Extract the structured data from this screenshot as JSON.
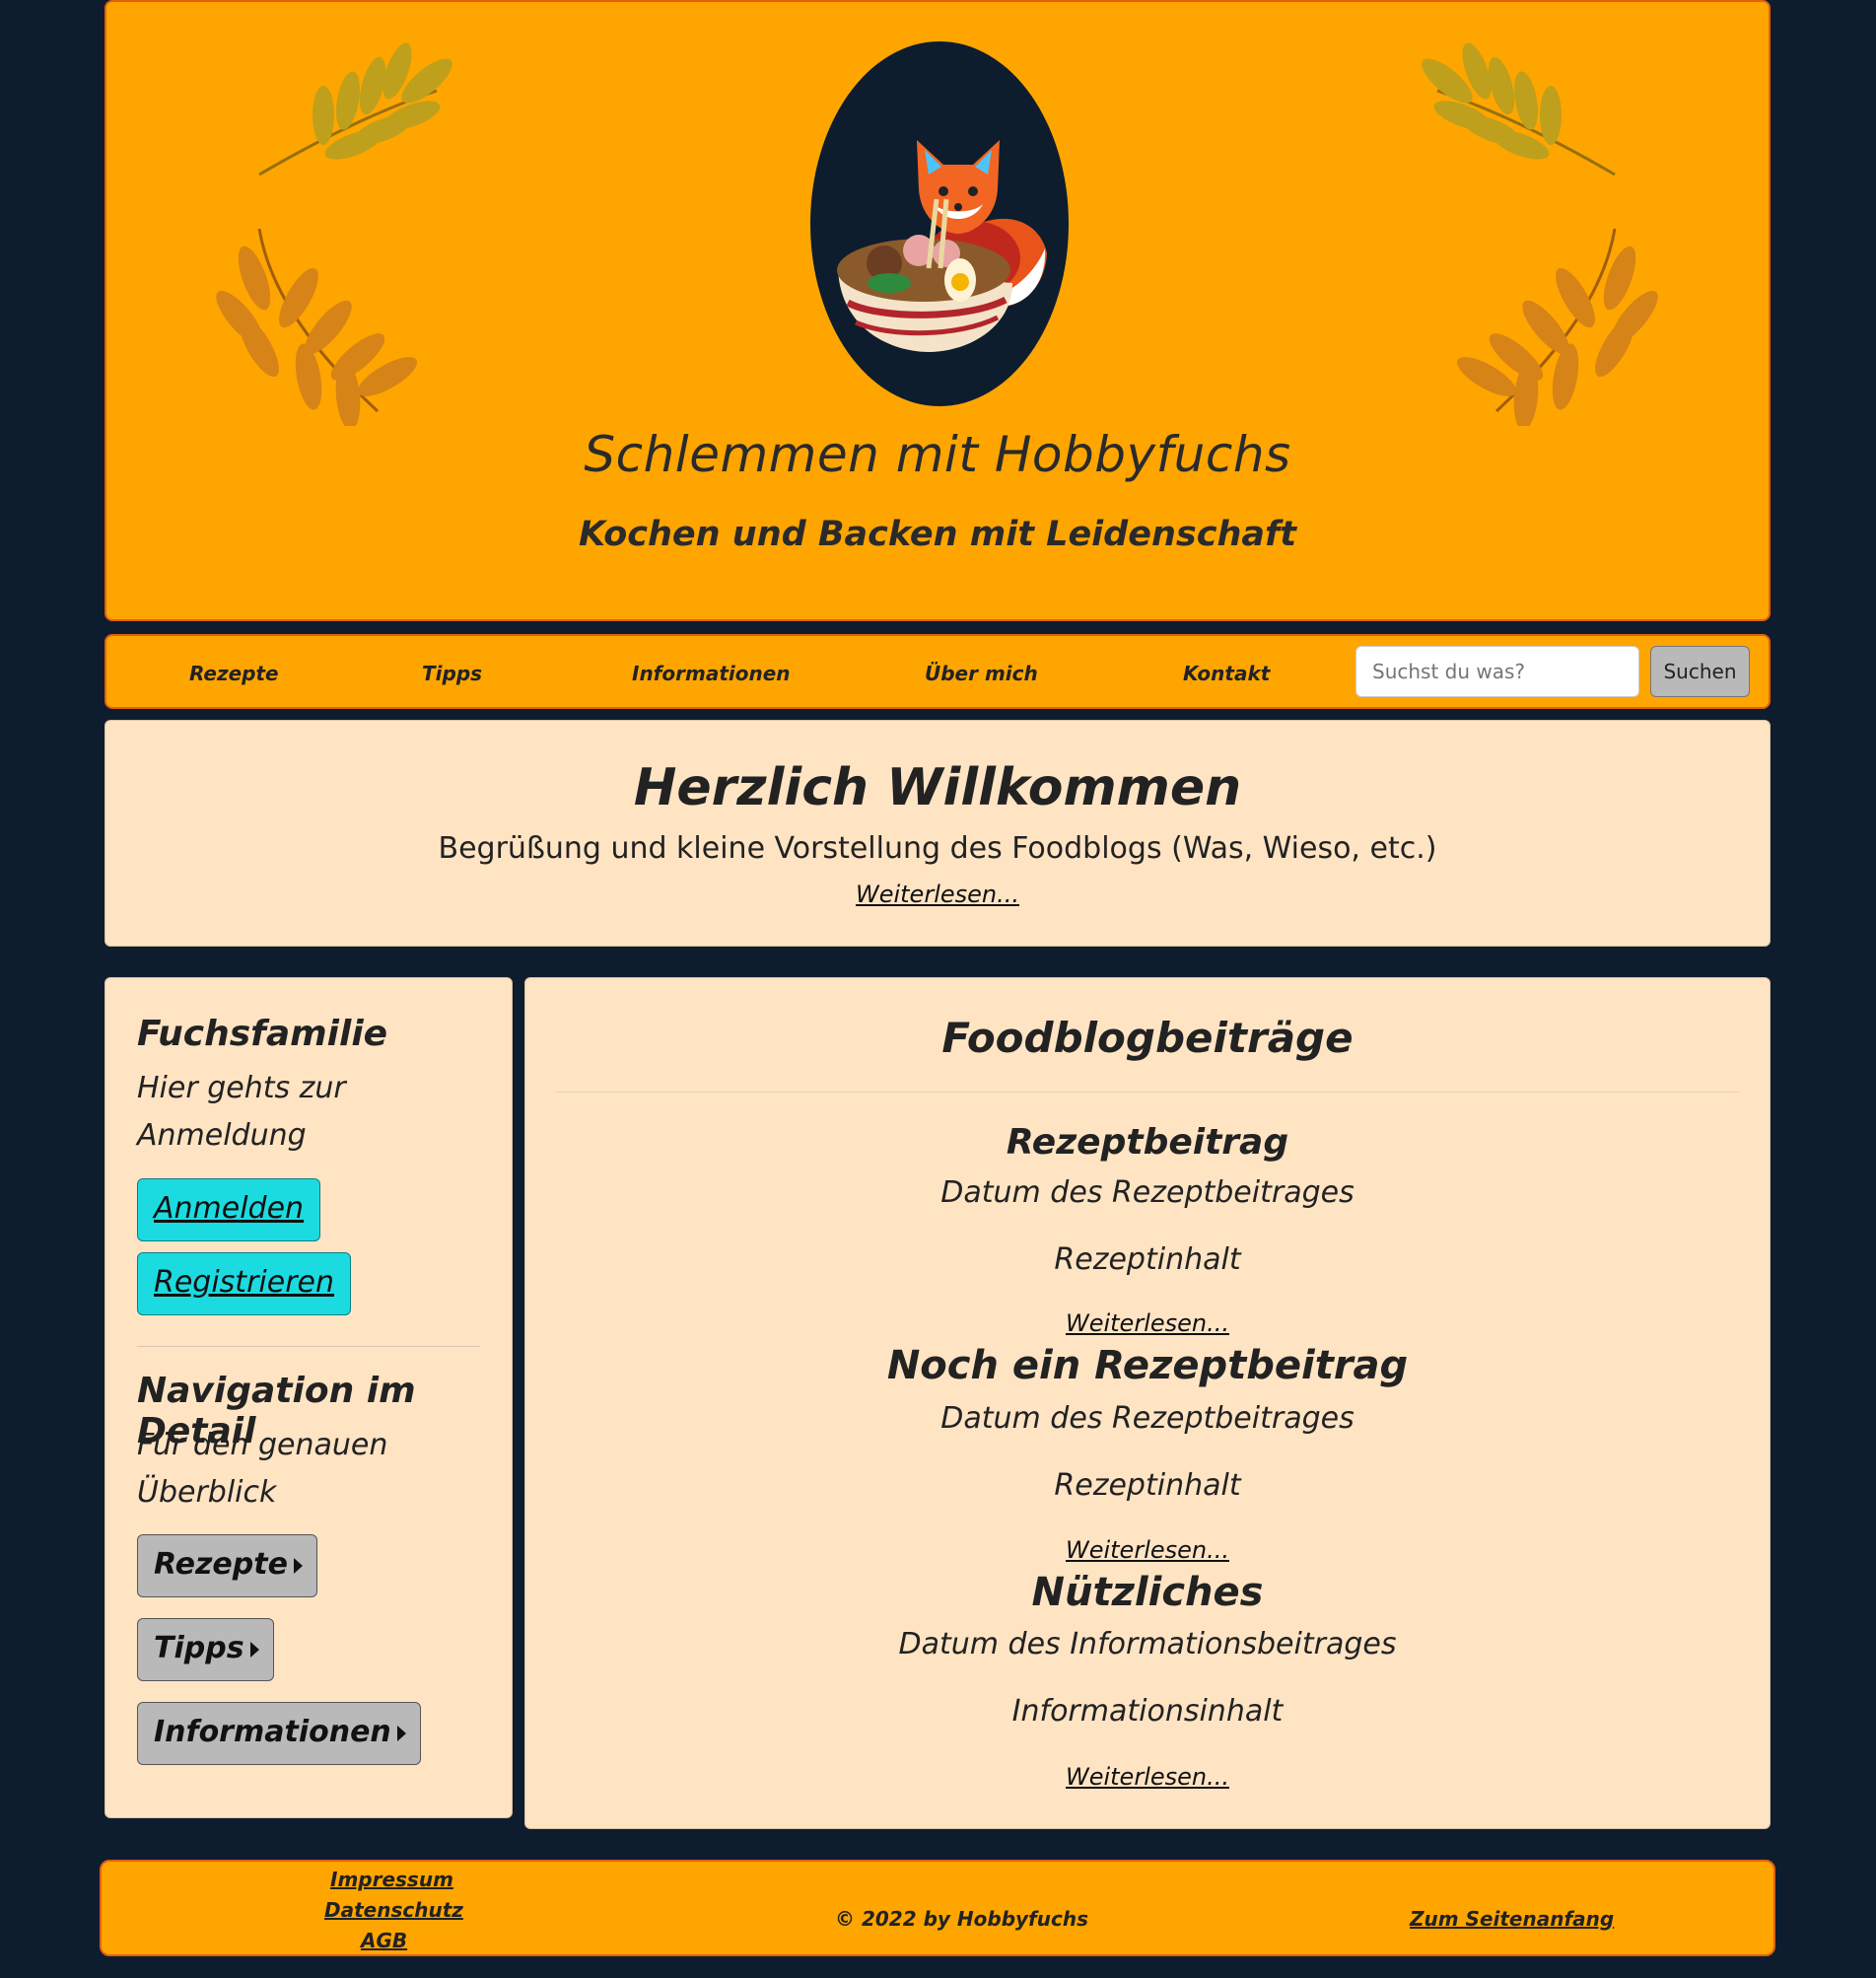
{
  "header": {
    "title": "Schlemmen mit Hobbyfuchs",
    "subtitle": "Kochen und Backen mit Leidenschaft",
    "logo_icon": "fox-ramen-logo",
    "decor_icon": "autumn-leaves-icon"
  },
  "nav": {
    "items": [
      "Rezepte",
      "Tipps",
      "Informationen",
      "Über mich",
      "Kontakt"
    ],
    "search_placeholder": "Suchst du was?",
    "search_button": "Suchen"
  },
  "welcome": {
    "heading": "Herzlich Willkommen",
    "text": "Begrüßung und kleine Vorstellung des Foodblogs (Was, Wieso, etc.)",
    "link": "Weiterlesen..."
  },
  "sidebar": {
    "family_heading": "Fuchsfamilie",
    "family_text": "Hier gehts zur Anmeldung",
    "login_button": "Anmelden",
    "register_button": "Registrieren",
    "nav_heading": "Navigation im Detail",
    "nav_text": "Für den genauen Überblick",
    "nav_buttons": [
      "Rezepte",
      "Tipps",
      "Informationen"
    ]
  },
  "main": {
    "heading": "Foodblogbeiträge",
    "posts": [
      {
        "title": "Rezeptbeitrag",
        "date": "Datum des Rezeptbeitrages",
        "content": "Rezeptinhalt",
        "link": "Weiterlesen..."
      },
      {
        "title": "Noch ein Rezeptbeitrag",
        "date": "Datum des Rezeptbeitrages",
        "content": "Rezeptinhalt",
        "link": "Weiterlesen..."
      },
      {
        "title": "Nützliches",
        "date": "Datum des Informationsbeitrages",
        "content": "Informationsinhalt",
        "link": "Weiterlesen..."
      }
    ]
  },
  "footer": {
    "impressum": "Impressum",
    "datenschutz": "Datenschutz",
    "agb": "AGB",
    "copyright": "© 2022 by Hobbyfuchs",
    "top_link": "Zum Seitenanfang"
  },
  "colors": {
    "background": "#0d1d2e",
    "header_orange": "#ffa500",
    "panel_bisque": "#ffe4c4",
    "button_cyan": "#1cdbe0",
    "button_grey": "#b9b9b9"
  }
}
